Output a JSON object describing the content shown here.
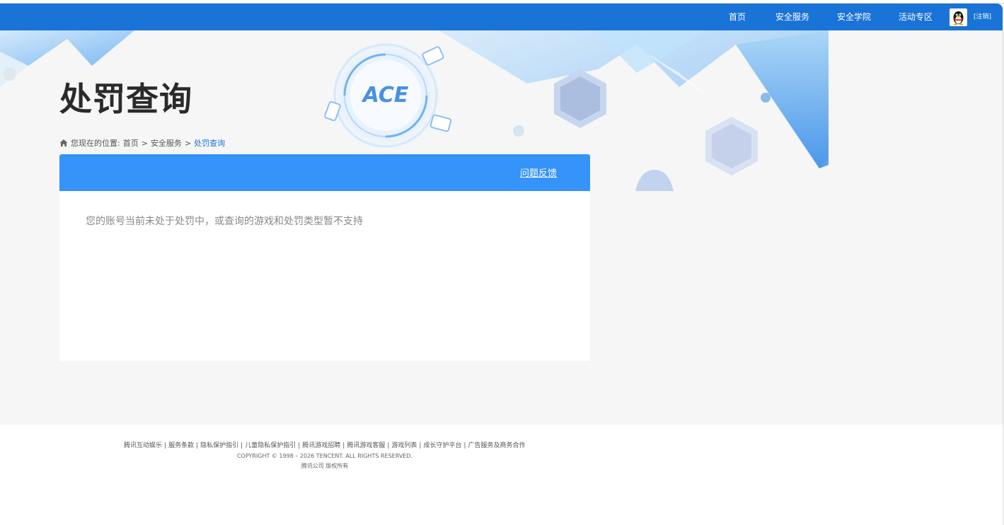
{
  "nav": {
    "items": [
      "首页",
      "安全服务",
      "安全学院",
      "活动专区"
    ],
    "logout": "[注销]"
  },
  "page": {
    "title": "处罚查询",
    "logo_text": "ACE"
  },
  "breadcrumb": {
    "prefix": "您现在的位置:",
    "items": [
      "首页",
      "安全服务",
      "处罚查询"
    ],
    "separator": ">"
  },
  "panel": {
    "feedback": "问题反馈",
    "message": "您的账号当前未处于处罚中，或查询的游戏和处罚类型暂不支持"
  },
  "footer": {
    "links": [
      "腾讯互动娱乐",
      "服务条款",
      "隐私保护指引",
      "儿童隐私保护指引",
      "腾讯游戏招聘",
      "腾讯游戏客服",
      "游戏列表",
      "成长守护平台",
      "广告服务及商务合作"
    ],
    "copyright": "COPYRIGHT © 1998 – 2026 TENCENT. ALL RIGHTS RESERVED.",
    "company": "腾讯公司 版权所有"
  },
  "colors": {
    "nav_bg": "#1a73d6",
    "panel_head": "#3593f9",
    "page_bg": "#f6f6f7",
    "breadcrumb_current": "#1a73d6"
  }
}
